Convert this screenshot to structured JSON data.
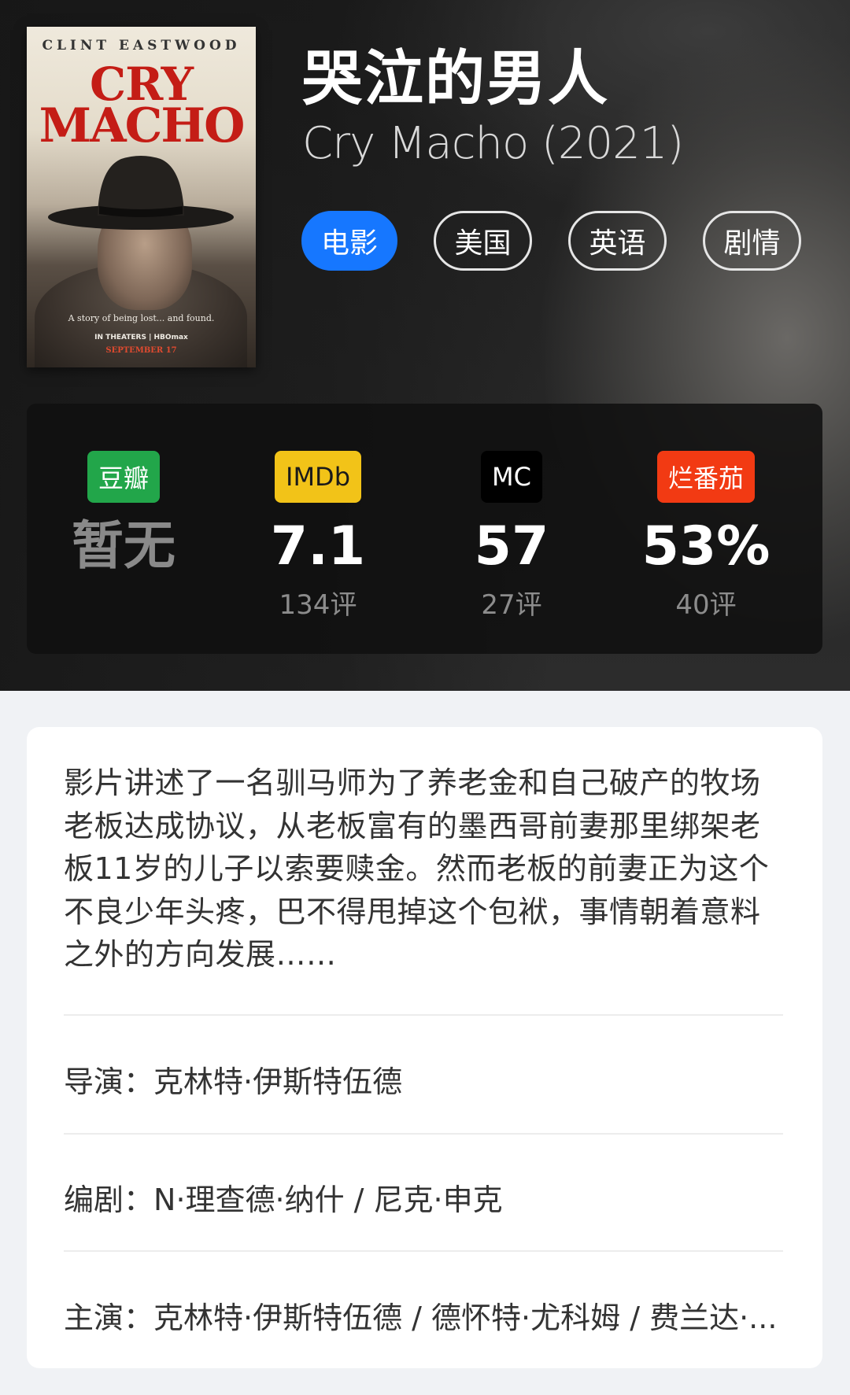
{
  "movie": {
    "title_cn": "哭泣的男人",
    "title_en": "Cry Macho (2021)",
    "tags": [
      {
        "label": "电影",
        "primary": true
      },
      {
        "label": "美国",
        "primary": false
      },
      {
        "label": "英语",
        "primary": false
      },
      {
        "label": "剧情",
        "primary": false
      }
    ]
  },
  "poster": {
    "actor": "CLINT EASTWOOD",
    "title_line1": "CRY",
    "title_line2": "MACHO",
    "tagline": "A story of being lost... and found.",
    "theaters": "IN THEATERS | HBOmax",
    "date": "SEPTEMBER 17"
  },
  "ratings": [
    {
      "source": "豆瓣",
      "score": "暂无",
      "count": "",
      "color": "#22a64a"
    },
    {
      "source": "IMDb",
      "score": "7.1",
      "count": "134评",
      "color": "#f2c318"
    },
    {
      "source": "MC",
      "score": "57",
      "count": "27评",
      "color": "#000000"
    },
    {
      "source": "烂番茄",
      "score": "53%",
      "count": "40评",
      "color": "#f23a13"
    }
  ],
  "info": {
    "synopsis": "影片讲述了一名驯马师为了养老金和自己破产的牧场老板达成协议，从老板富有的墨西哥前妻那里绑架老板11岁的儿子以索要赎金。然而老板的前妻正为这个不良少年头疼，巴不得甩掉这个包袱，事情朝着意料之外的方向发展……",
    "director_label": "导演：",
    "director": "克林特·伊斯特伍德",
    "writer_label": "编剧：",
    "writer": "N·理查德·纳什 / 尼克·申克",
    "cast_label": "主演：",
    "cast": "克林特·伊斯特伍德 / 德怀特·尤科姆 / 费兰达·..."
  }
}
